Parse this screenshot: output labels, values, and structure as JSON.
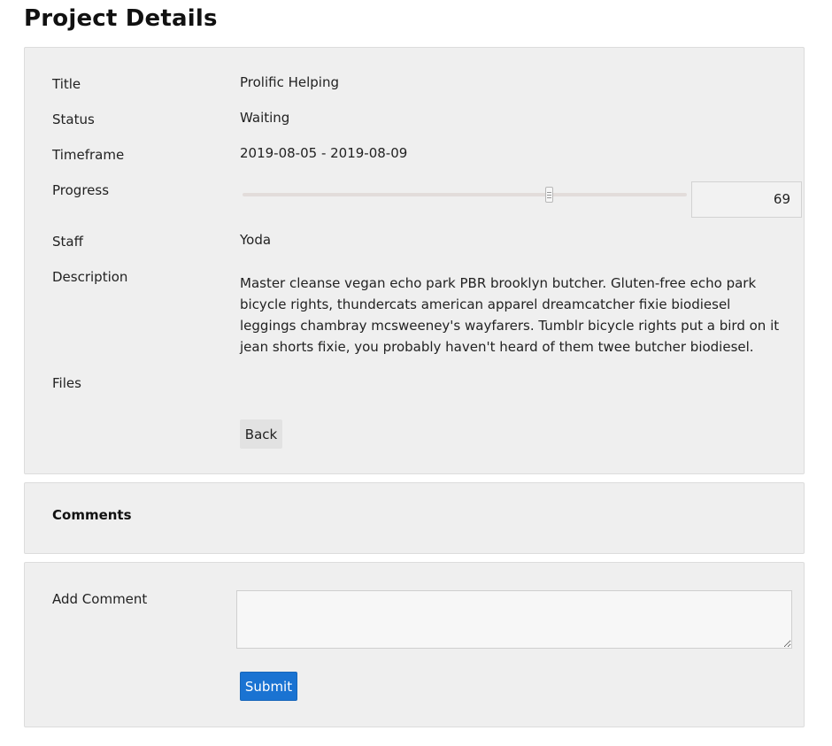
{
  "page": {
    "title": "Project Details"
  },
  "details": {
    "labels": {
      "title": "Title",
      "status": "Status",
      "timeframe": "Timeframe",
      "progress": "Progress",
      "staff": "Staff",
      "description": "Description",
      "files": "Files"
    },
    "values": {
      "title": "Prolific Helping",
      "status": "Waiting",
      "timeframe": "2019-08-05 - 2019-08-09",
      "progress": "69",
      "staff": "Yoda",
      "description": "Master cleanse vegan echo park PBR brooklyn butcher. Gluten-free echo park bicycle rights, thundercats american apparel dreamcatcher fixie biodiesel leggings chambray mcsweeney's wayfarers. Tumblr bicycle rights put a bird on it jean shorts fixie, you probably haven't heard of them twee butcher biodiesel."
    },
    "progress_fraction": 0.69,
    "back_label": "Back"
  },
  "comments": {
    "heading": "Comments"
  },
  "add_comment": {
    "label": "Add Comment",
    "textarea_value": "",
    "submit_label": "Submit"
  },
  "colors": {
    "panel_bg": "#efefef",
    "submit_bg": "#1a73d2",
    "back_bg": "#e2e2e2"
  }
}
